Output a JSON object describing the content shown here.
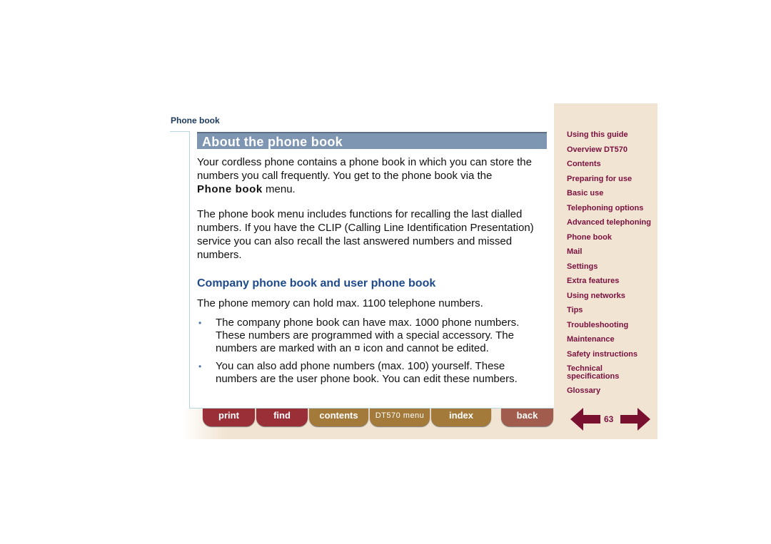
{
  "header": {
    "section": "Phone book"
  },
  "main": {
    "title": "About the phone book",
    "para1_a": "Your cordless phone contains a phone book in which you can store the numbers you call frequently. You get to the phone book via the",
    "para1_menu": "Phone book",
    "para1_b": " menu.",
    "para2": "The phone book menu includes functions for recalling the last dialled numbers. If you have the CLIP (Calling Line Identification Presentation) service you can also recall the last answered numbers and missed numbers.",
    "subheading": "Company phone book and user phone book",
    "para3": "The phone memory can hold max. 1100 telephone numbers.",
    "bullets": [
      "The company phone book can have max. 1000 phone numbers. These numbers are programmed with a special accessory. The numbers are marked with an ¤ icon and cannot be edited.",
      "You can also add phone numbers (max. 100) yourself. These numbers are the user phone book. You can edit these numbers."
    ],
    "bullet_glyph": "•"
  },
  "sidebar": {
    "items": [
      "Using this guide",
      "Overview DT570",
      "Contents",
      "Preparing for use",
      "Basic use",
      "Telephoning options",
      "Advanced telephoning",
      "Phone book",
      "Mail",
      "Settings",
      "Extra features",
      "Using networks",
      "Tips",
      "Troubleshooting",
      "Maintenance",
      "Safety instructions",
      "Technical specifications",
      "Glossary"
    ]
  },
  "footer": {
    "buttons": [
      "print",
      "find",
      "contents",
      "DT570 menu",
      "index",
      "back"
    ],
    "page": "63"
  },
  "colors": {
    "link": "#7a1040",
    "title_bar": "#7f96b2",
    "heading": "#1e4a8c",
    "sidebar_bg": "#f2e4d2"
  }
}
